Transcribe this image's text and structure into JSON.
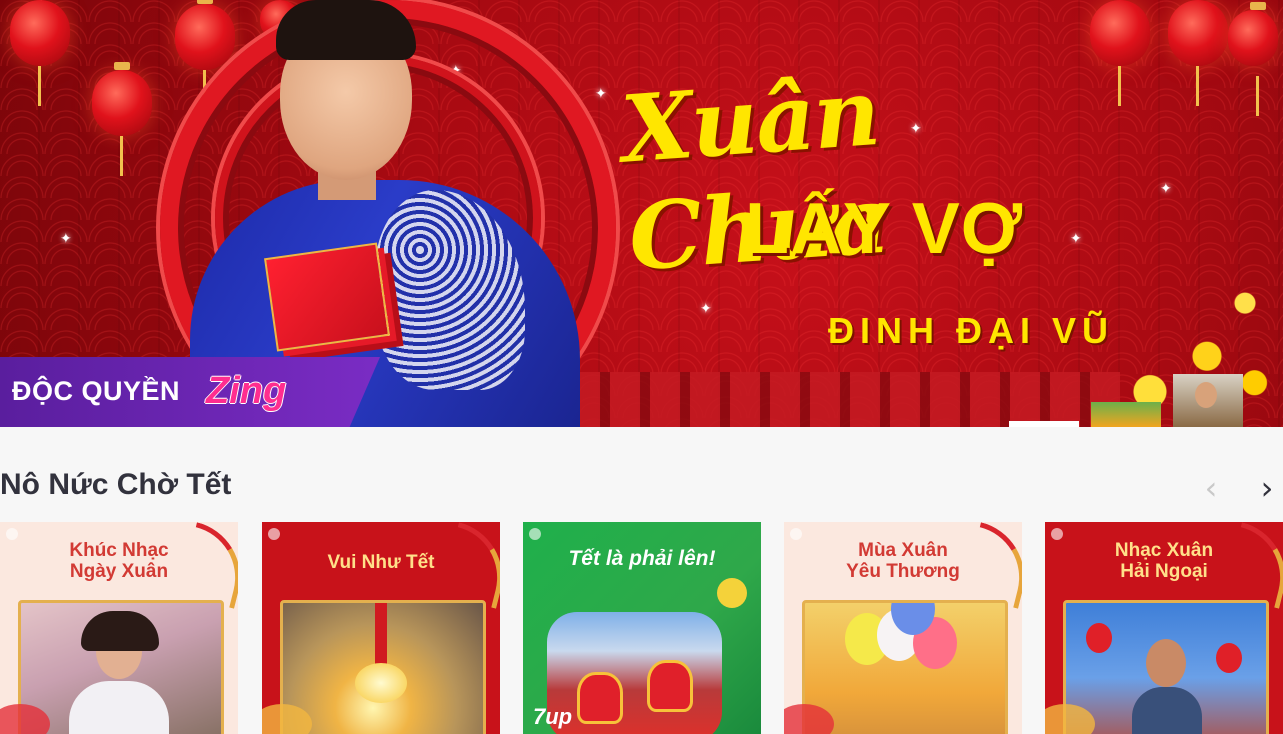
{
  "banner": {
    "title_script": "Xuân Chưa",
    "title_main": "LẤY VỢ",
    "artist": "ĐINH ĐẠI VŨ",
    "exclusive_label": "ĐỘC QUYỀN",
    "brand_logo": "Zing",
    "colors": {
      "accent_yellow": "#ffe600",
      "banner_red": "#b00c14",
      "exclusive_purple": "#6a24b0",
      "zing_pink": "#ff2d8f"
    }
  },
  "section": {
    "title": "Nô Nức Chờ Tết",
    "prev_icon": "‹",
    "next_icon": "›"
  },
  "playlists": [
    {
      "title": "Khúc Nhạc\nNgày Xuân"
    },
    {
      "title": "Vui Như Tết"
    },
    {
      "title": "Tết là phải lên!"
    },
    {
      "title": "Mùa Xuân\nYêu Thương"
    },
    {
      "title": "Nhạc Xuân\nHải Ngoại"
    }
  ],
  "card_badge": "7up"
}
